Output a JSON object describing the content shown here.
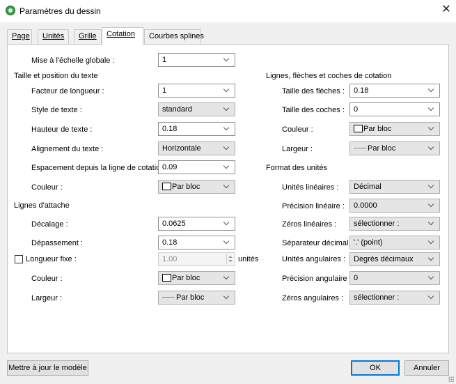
{
  "window": {
    "title": "Paramètres du dessin",
    "close_glyph": "✕"
  },
  "tabs": [
    "Page",
    "Unités",
    "Grille",
    "Cotation",
    "Courbes splines"
  ],
  "active_tab": "Cotation",
  "global_scale": {
    "label": "Mise à l'échelle globale :",
    "value": "1"
  },
  "text": {
    "section": "Taille et position du texte",
    "length_factor": {
      "label": "Facteur de longueur :",
      "value": "1"
    },
    "text_style": {
      "label": "Style de texte :",
      "value": "standard"
    },
    "text_height": {
      "label": "Hauteur de texte :",
      "value": "0.18"
    },
    "text_align": {
      "label": "Alignement du texte :",
      "value": "Horizontale"
    },
    "spacing": {
      "label": "Espacement depuis la ligne de cotation :",
      "value": "0.09"
    },
    "color": {
      "label": "Couleur :",
      "value": "Par bloc"
    }
  },
  "extension": {
    "section": "Lignes d'attache",
    "offset": {
      "label": "Décalage :",
      "value": "0.0625"
    },
    "overshoot": {
      "label": "Dépassement :",
      "value": "0.18"
    },
    "fixed_length": {
      "label": "Longueur fixe :",
      "value": "1.00",
      "unit": "unités",
      "checked": false
    },
    "color": {
      "label": "Couleur :",
      "value": "Par bloc"
    },
    "width": {
      "label": "Largeur :",
      "value": "Par bloc"
    }
  },
  "lines": {
    "section": "Lignes, flèches et coches de cotation",
    "arrow_size": {
      "label": "Taille des flèches :",
      "value": "0.18"
    },
    "tick_size": {
      "label": "Taille des coches :",
      "value": "0"
    },
    "color": {
      "label": "Couleur :",
      "value": "Par bloc"
    },
    "width": {
      "label": "Largeur :",
      "value": "Par bloc"
    }
  },
  "units": {
    "section": "Format des unités",
    "linear_units": {
      "label": "Unités linéaires :",
      "value": "Décimal"
    },
    "linear_precision": {
      "label": "Précision linéaire :",
      "value": "0.0000"
    },
    "linear_zeros": {
      "label": "Zéros linéaires :",
      "value": "sélectionner :"
    },
    "decimal_sep": {
      "label": "Séparateur décimal :",
      "value": "'.' (point)"
    },
    "angular_units": {
      "label": "Unités angulaires :",
      "value": "Degrés décimaux"
    },
    "angular_precision": {
      "label": "Précision angulaire :",
      "value": "0"
    },
    "angular_zeros": {
      "label": "Zéros angulaires :",
      "value": "sélectionner :"
    }
  },
  "buttons": {
    "update": "Mettre à jour le modèle",
    "ok": "OK",
    "cancel": "Annuler"
  }
}
